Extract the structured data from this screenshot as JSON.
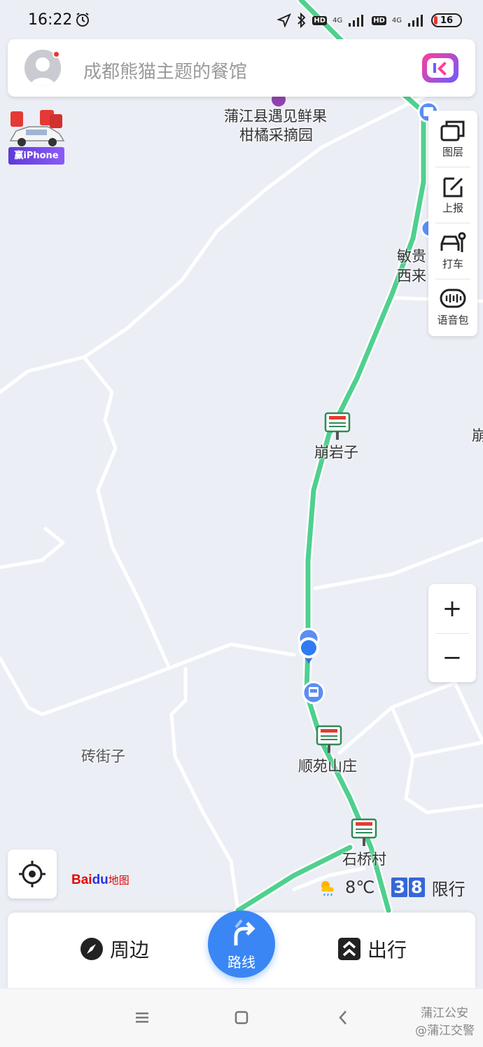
{
  "status_bar": {
    "time": "16:22",
    "network_badge_1": "HD",
    "network_1": "4G",
    "network_badge_2": "HD",
    "network_2": "4G",
    "battery": "16",
    "icons": [
      "alarm-icon",
      "location-arrow-icon",
      "bluetooth-icon",
      "signal-icon",
      "battery-icon"
    ]
  },
  "search": {
    "placeholder": "成都熊猫主题的餐馆"
  },
  "promo": {
    "label": "赢iPhone"
  },
  "toolbar": {
    "items": [
      {
        "label": "图层",
        "icon": "layers-icon"
      },
      {
        "label": "上报",
        "icon": "report-edit-icon"
      },
      {
        "label": "打车",
        "icon": "taxi-icon"
      },
      {
        "label": "语音包",
        "icon": "voice-pack-icon"
      }
    ]
  },
  "map": {
    "poi_orchard_line1": "蒲江县遇见鲜果",
    "poi_orchard_line2": "柑橘采摘园",
    "label_mingui_1": "敏贵",
    "label_mingui_2": "西来",
    "label_edge": "崩",
    "toll_1": "崩岩子",
    "toll_2": "顺苑山庄",
    "toll_3": "石桥村",
    "village": "砖街子",
    "route_color": "#4fd08f"
  },
  "zoom": {
    "in": "+",
    "out": "−"
  },
  "weather": {
    "temperature": "8℃",
    "limit_digit_1": "3",
    "limit_digit_2": "8",
    "limit_label": "限行"
  },
  "brand": {
    "logo_left": "Bai",
    "logo_mid": "du",
    "logo_right": "地图"
  },
  "bottom": {
    "nearby": "周边",
    "route": "路线",
    "travel": "出行"
  },
  "watermark": {
    "line1": "蒲江公安",
    "line2": "@蒲江交警"
  },
  "colors": {
    "accent": "#3a86f5",
    "route_green": "#4fd08f",
    "brand_red": "#e10602"
  }
}
